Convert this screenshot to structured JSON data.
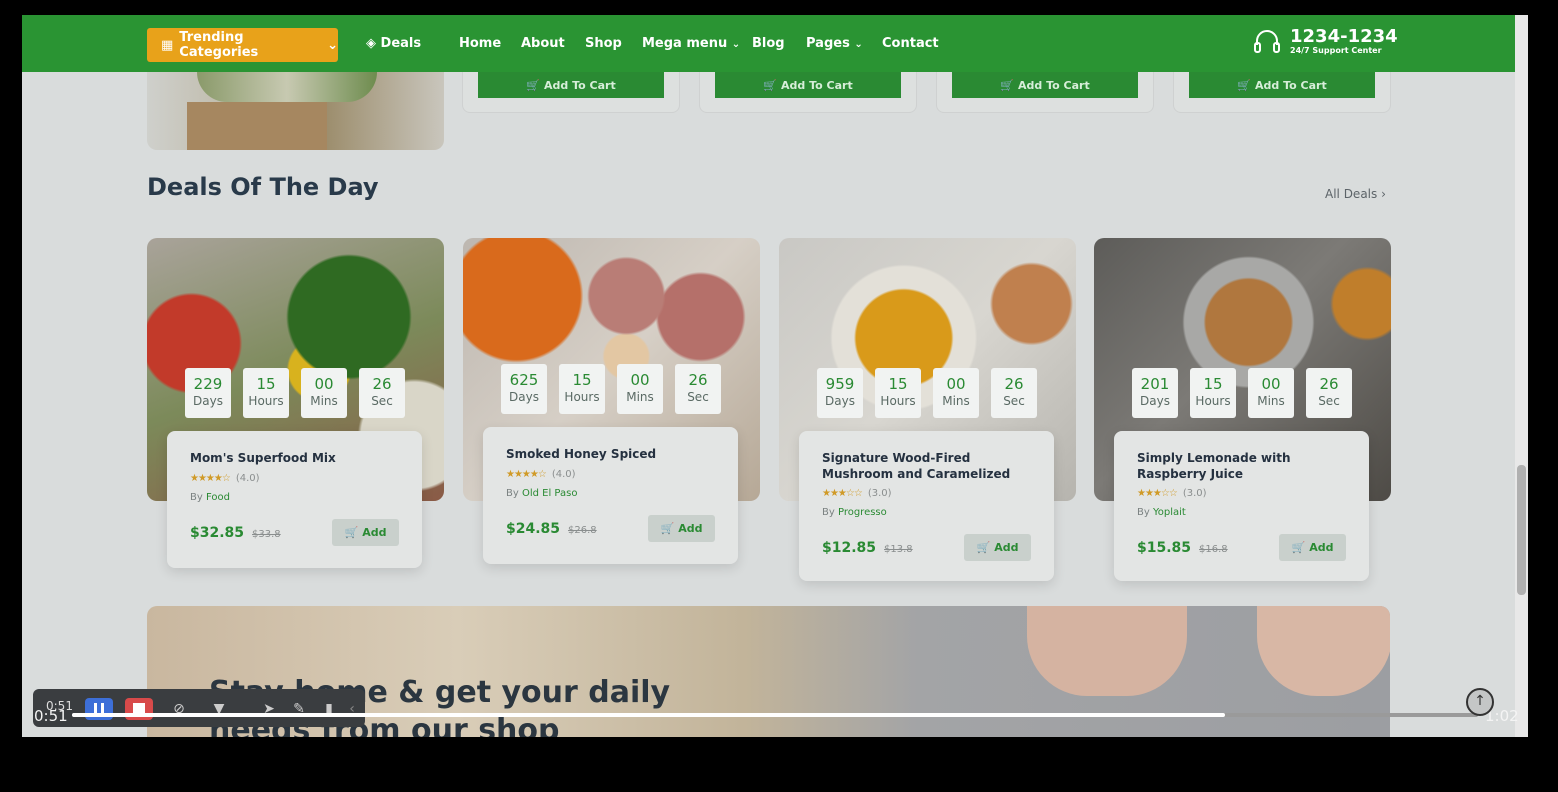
{
  "nav": {
    "trending_label": "Trending Categories",
    "deals_label": "Deals",
    "links": [
      "Home",
      "About",
      "Shop",
      "Mega menu",
      "Blog",
      "Pages",
      "Contact"
    ],
    "phone": "1234-1234",
    "support_label": "24/7 Support Center"
  },
  "top_cards": {
    "add_to_cart_label": "Add To Cart"
  },
  "section": {
    "title": "Deals Of The Day",
    "all_deals_label": "All Deals"
  },
  "timer_labels": {
    "days": "Days",
    "hours": "Hours",
    "mins": "Mins",
    "sec": "Sec"
  },
  "deals": [
    {
      "days": "229",
      "hours": "15",
      "mins": "00",
      "sec": "26",
      "name": "Mom's Superfood Mix",
      "rating": "(4.0)",
      "stars": 4,
      "by_prefix": "By",
      "brand": "Food",
      "price": "$32.85",
      "old_price": "$33.8",
      "add_label": "Add"
    },
    {
      "days": "625",
      "hours": "15",
      "mins": "00",
      "sec": "26",
      "name": "Smoked Honey Spiced",
      "rating": "(4.0)",
      "stars": 4,
      "by_prefix": "By",
      "brand": "Old El Paso",
      "price": "$24.85",
      "old_price": "$26.8",
      "add_label": "Add"
    },
    {
      "days": "959",
      "hours": "15",
      "mins": "00",
      "sec": "26",
      "name": "Signature Wood-Fired Mushroom and Caramelized",
      "rating": "(3.0)",
      "stars": 3,
      "by_prefix": "By",
      "brand": "Progresso",
      "price": "$12.85",
      "old_price": "$13.8",
      "add_label": "Add"
    },
    {
      "days": "201",
      "hours": "15",
      "mins": "00",
      "sec": "26",
      "name": "Simply Lemonade with Raspberry Juice",
      "rating": "(3.0)",
      "stars": 3,
      "by_prefix": "By",
      "brand": "Yoplait",
      "price": "$15.85",
      "old_price": "$16.8",
      "add_label": "Add"
    }
  ],
  "banner": {
    "line1": "Stay home & get your daily",
    "line2": "needs from our shop"
  },
  "video": {
    "current_time": "0:51",
    "duration": "1:02",
    "progress": 0.82,
    "overlay_time": "0:51"
  },
  "colors": {
    "brand_green": "#2a9433",
    "accent_orange": "#e8a21a",
    "price_green": "#2a8a33"
  }
}
